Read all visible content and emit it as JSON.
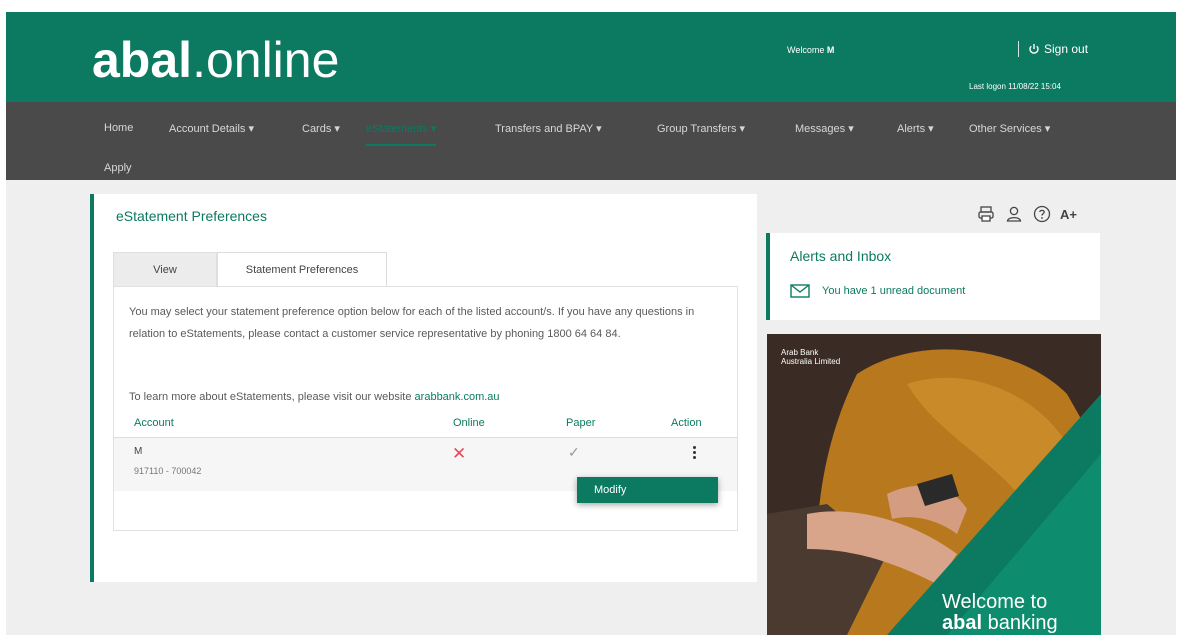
{
  "header": {
    "logo_bold": "abal",
    "logo_light": ".online",
    "welcome_prefix": "Welcome ",
    "welcome_name": "M",
    "sign_out": "Sign out",
    "last_logon": "Last logon 11/08/22 15:04",
    "bg_color": "#0b7a60"
  },
  "nav": {
    "items": [
      {
        "label": "Home"
      },
      {
        "label": "Account Details ▾"
      },
      {
        "label": "Cards ▾"
      },
      {
        "label": "eStatements ▾",
        "active": true
      },
      {
        "label": "Transfers and BPAY ▾"
      },
      {
        "label": "Group Transfers ▾"
      },
      {
        "label": "Messages ▾"
      },
      {
        "label": "Alerts ▾"
      },
      {
        "label": "Other Services ▾"
      },
      {
        "label": "Apply"
      }
    ]
  },
  "main": {
    "title": "eStatement Preferences",
    "tabs": [
      {
        "label": "View"
      },
      {
        "label": "Statement Preferences",
        "active": true
      }
    ],
    "description": "You may select your statement preference option below for each of the listed account/s. If you have any questions in relation to eStatements, please contact a customer service representative by phoning 1800 64 64 84.",
    "learn_prefix": "To learn more about eStatements, please visit our website ",
    "learn_link": "arabbank.com.au",
    "table": {
      "headers": {
        "account": "Account",
        "online": "Online",
        "paper": "Paper",
        "action": "Action"
      },
      "rows": [
        {
          "account_name": "M",
          "account_number": "917110 - 700042",
          "online": "✕",
          "paper": "✓"
        }
      ]
    },
    "menu": {
      "modify": "Modify"
    }
  },
  "tools": {
    "icons": [
      "printer-icon",
      "user-icon",
      "help-icon"
    ],
    "text_size": "A+"
  },
  "alerts": {
    "title": "Alerts and Inbox",
    "message": "You have 1 unread document"
  },
  "promo": {
    "brand": "Arab Bank Australia Limited",
    "welcome": "Welcome to",
    "banking_bold": "abal",
    "banking_light": " banking"
  },
  "colors": {
    "accent": "#0b7a60",
    "nav_bg": "#4a4a4a",
    "error": "#e24a5a"
  }
}
